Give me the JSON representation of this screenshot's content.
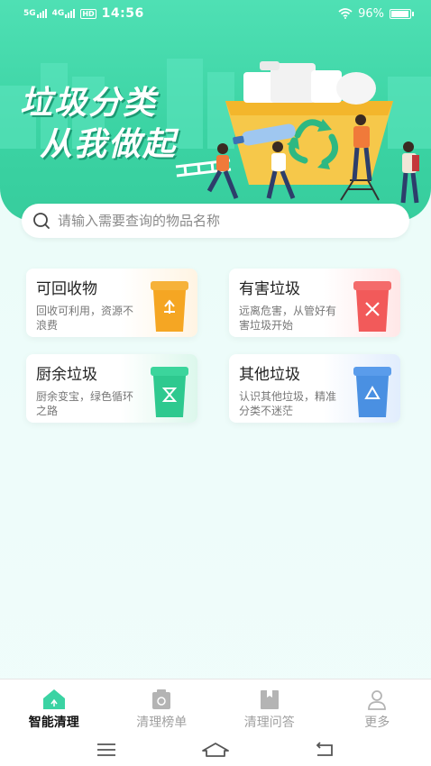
{
  "status_bar": {
    "network_1": "5G",
    "network_2": "4G",
    "hd": "HD",
    "time": "14:56",
    "battery": "96%"
  },
  "banner": {
    "title_line1": "垃圾分类",
    "title_line2": "从我做起"
  },
  "search": {
    "placeholder": "请输入需要查询的物品名称"
  },
  "categories": [
    {
      "title": "可回收物",
      "desc": "回收可利用，资源不浪费",
      "color": "#f5a623"
    },
    {
      "title": "有害垃圾",
      "desc": "远离危害，从管好有害垃圾开始",
      "color": "#f25a5a"
    },
    {
      "title": "厨余垃圾",
      "desc": "厨余变宝，绿色循环之路",
      "color": "#2ec98f"
    },
    {
      "title": "其他垃圾",
      "desc": "认识其他垃圾，精准分类不迷茫",
      "color": "#4a90e2"
    }
  ],
  "tabs": [
    {
      "label": "智能清理",
      "icon": "home-icon",
      "active": true
    },
    {
      "label": "清理榜单",
      "icon": "ranking-icon",
      "active": false
    },
    {
      "label": "清理问答",
      "icon": "qa-icon",
      "active": false
    },
    {
      "label": "更多",
      "icon": "user-icon",
      "active": false
    }
  ],
  "colors": {
    "accent": "#3bd3a3",
    "active_tab_icon": "#3bd3a3",
    "inactive_tab": "#a0a0a0"
  }
}
